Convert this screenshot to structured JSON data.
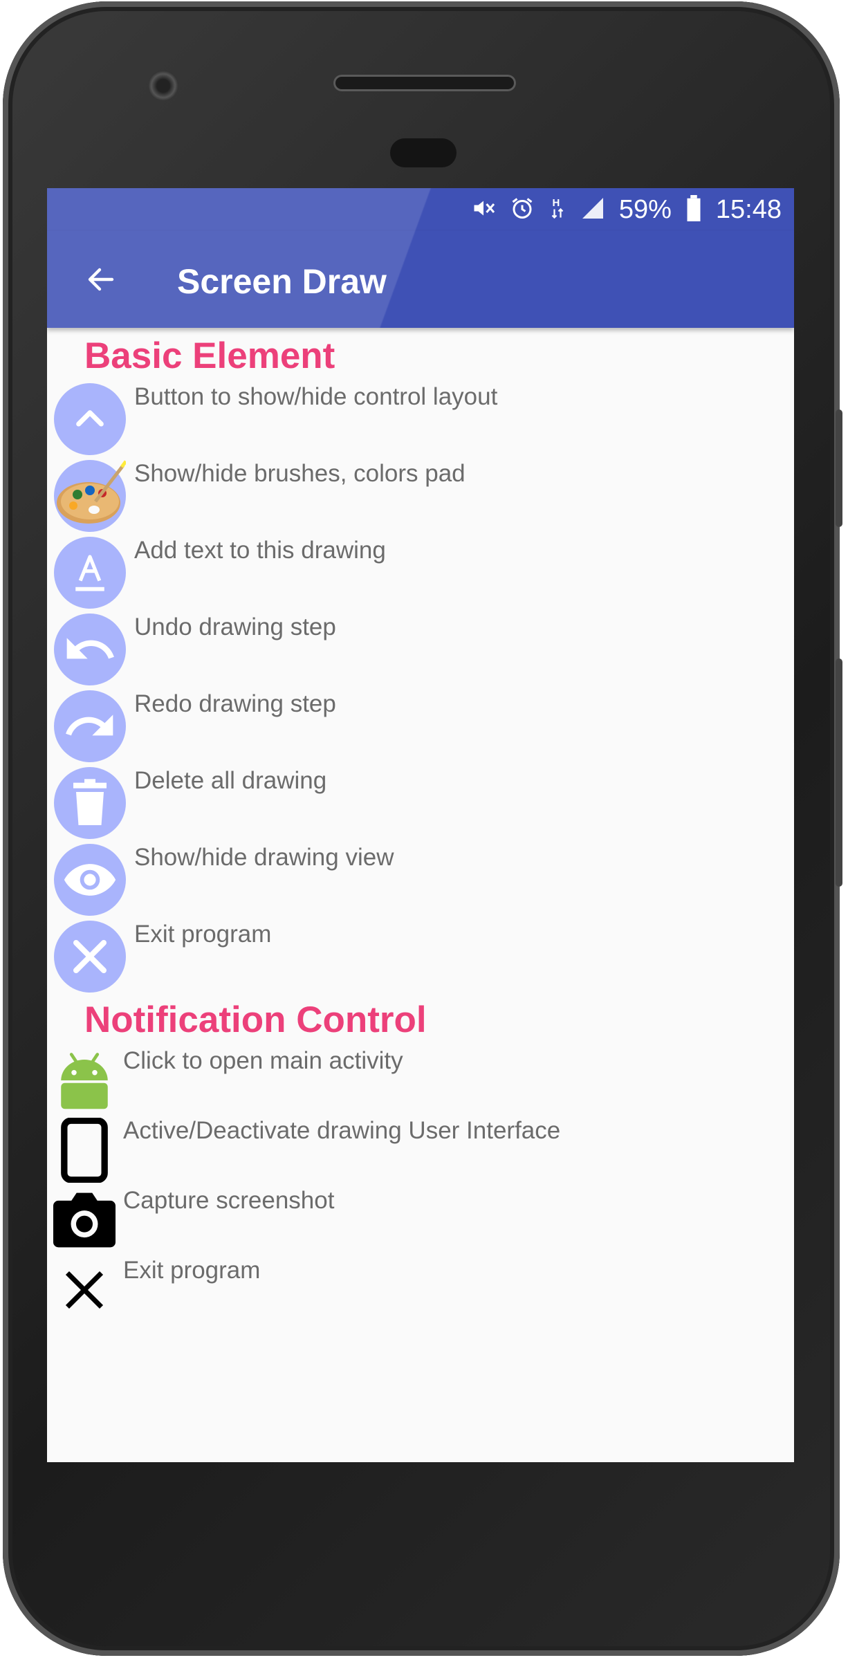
{
  "status_bar": {
    "icons": [
      "mute-icon",
      "alarm-icon",
      "network-h-icon",
      "signal-icon",
      "battery-icon"
    ],
    "battery": "59%",
    "time": "15:48"
  },
  "app_bar": {
    "title": "Screen Draw",
    "back_icon": "arrow-back-icon",
    "color": "#3f51b5"
  },
  "sections": {
    "basic": {
      "title": "Basic Element",
      "items": [
        {
          "icon": "chevron-up-icon",
          "label": "Button to show/hide control layout"
        },
        {
          "icon": "palette-icon",
          "label": "Show/hide brushes, colors pad"
        },
        {
          "icon": "text-icon",
          "label": "Add text to this drawing"
        },
        {
          "icon": "undo-icon",
          "label": "Undo drawing step"
        },
        {
          "icon": "redo-icon",
          "label": "Redo drawing step"
        },
        {
          "icon": "trash-icon",
          "label": "Delete all drawing"
        },
        {
          "icon": "eye-icon",
          "label": "Show/hide drawing view"
        },
        {
          "icon": "close-icon",
          "label": "Exit program"
        }
      ]
    },
    "notification": {
      "title": "Notification Control",
      "items": [
        {
          "icon": "android-icon",
          "label": "Click to open main activity"
        },
        {
          "icon": "phone-icon",
          "label": "Active/Deactivate drawing User Interface"
        },
        {
          "icon": "camera-icon",
          "label": "Capture screenshot"
        },
        {
          "icon": "close-icon",
          "label": "Exit program"
        }
      ]
    }
  },
  "colors": {
    "accent": "#ec407a",
    "icon_circle": "#a9b4fc",
    "label_text": "#6b6b6b"
  }
}
